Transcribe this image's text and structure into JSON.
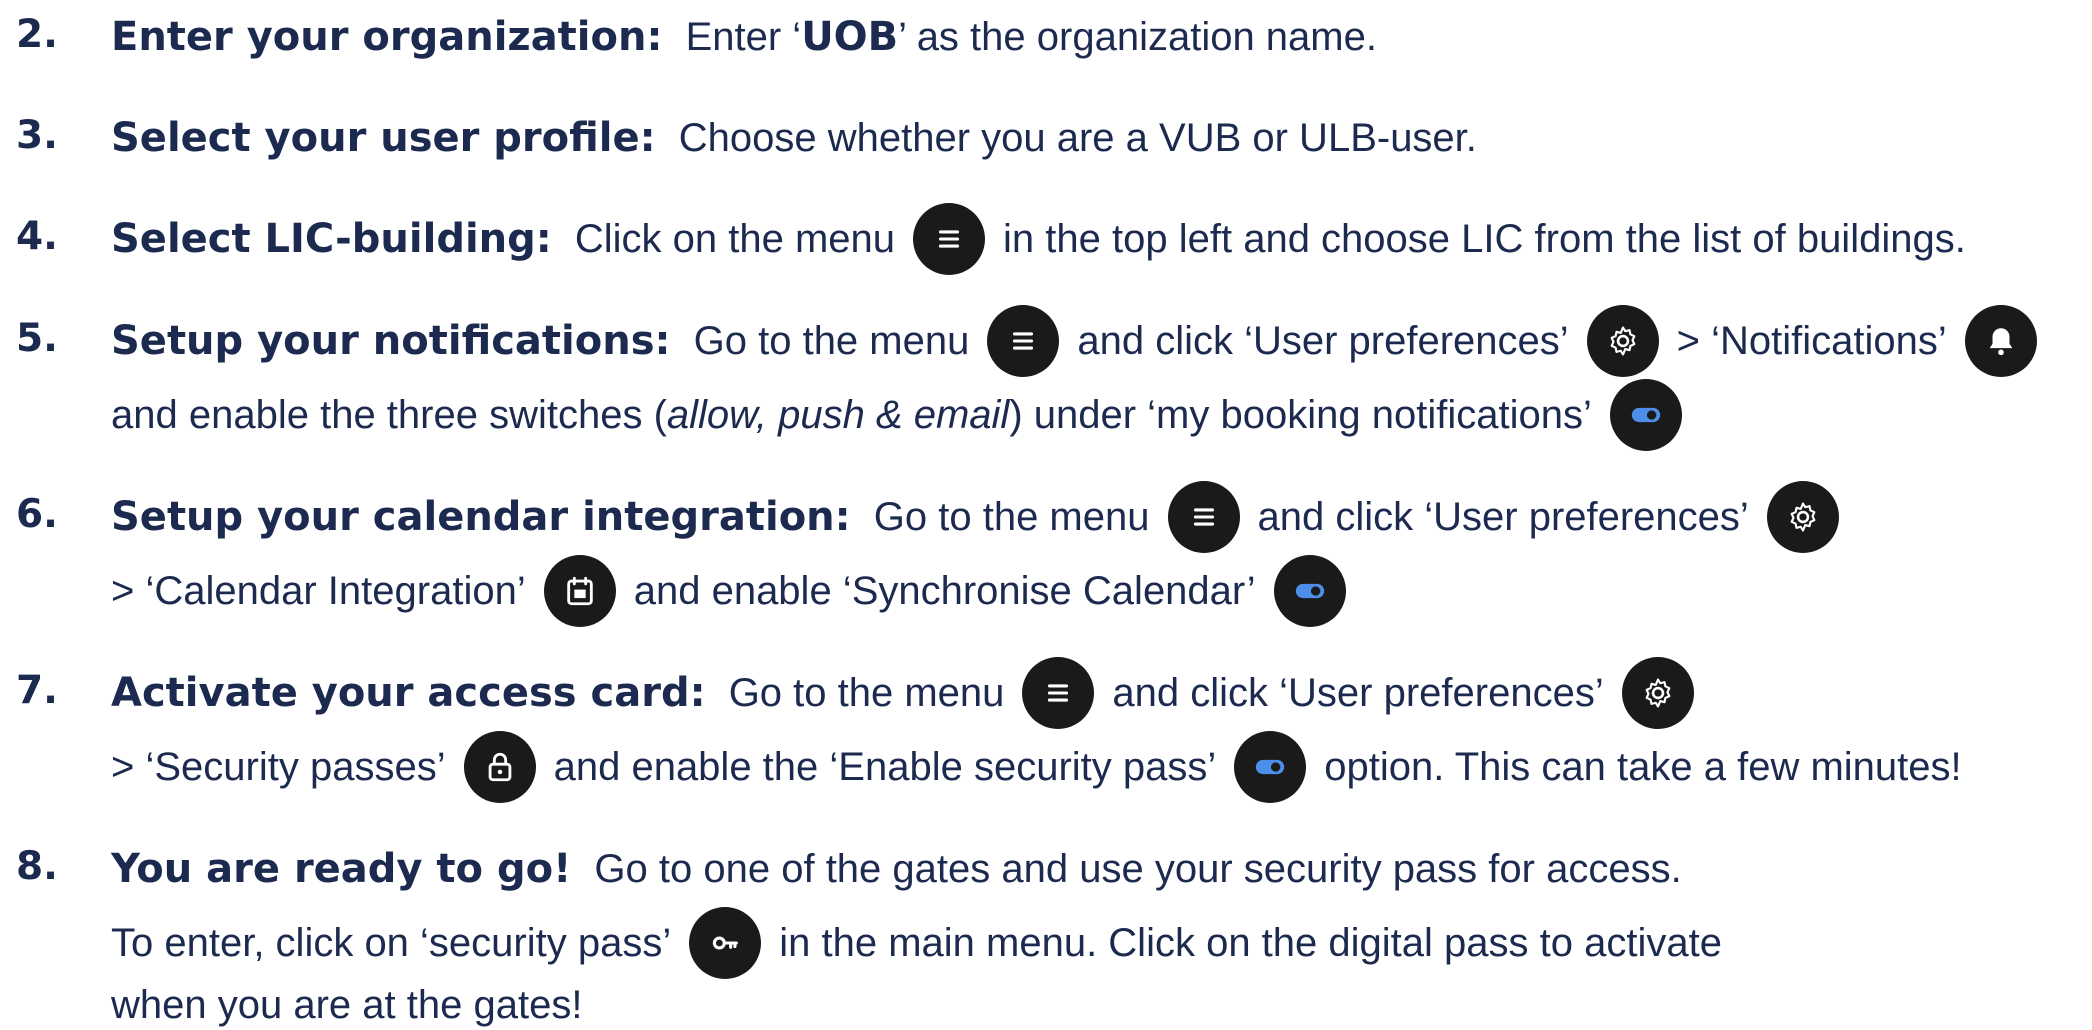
{
  "steps": [
    {
      "num": "2.",
      "heading": "Enter your organization:",
      "t1": " Enter ‘",
      "b1": "UOB",
      "t2": "’ as the organization name."
    },
    {
      "num": "3.",
      "heading": "Select your user profile:",
      "t1": " Choose whether you are a VUB or ULB-user."
    },
    {
      "num": "4.",
      "heading": "Select LIC-building:",
      "t1": " Click on the menu",
      "t2": "in the top left and choose LIC from the list of buildings."
    },
    {
      "num": "5.",
      "heading": "Setup your notifications:",
      "t1": " Go to the menu",
      "t2": "and click ‘User preferences’",
      "t3": "> ‘Notifications’",
      "l2a": "and enable the three switches (",
      "l2b": "allow, push & email",
      "l2c": ") under ‘my booking notifications’"
    },
    {
      "num": "6.",
      "heading": "Setup your calendar integration:",
      "t1": " Go to the menu",
      "t2": "and click ‘User preferences’",
      "l2a": "> ‘Calendar Integration’",
      "l2b": "and enable ‘Synchronise Calendar’"
    },
    {
      "num": "7.",
      "heading": "Activate your access card:",
      "t1": " Go to the menu",
      "t2": "and click ‘User preferences’",
      "l2a": "> ‘Security passes’",
      "l2b": "and enable the ‘Enable security pass’",
      "l2c": "option. This can take a few minutes!"
    },
    {
      "num": "8.",
      "heading": "You are ready to go!",
      "t1": " Go to one of the gates and use your security pass for access.",
      "l2a": "To enter, click on ‘security pass’",
      "l2b": "in the main menu. Click on the digital pass to activate",
      "l3": "when you are at the gates!"
    }
  ],
  "icons": {
    "menu": "menu-icon",
    "gear": "gear-icon",
    "bell": "bell-icon",
    "toggle": "toggle-on-icon",
    "calendar": "calendar-icon",
    "lock": "lock-icon",
    "key": "key-icon"
  },
  "colors": {
    "text": "#1c2a4f",
    "icon_bg": "#1a1a1a",
    "toggle": "#4d8fe8"
  }
}
